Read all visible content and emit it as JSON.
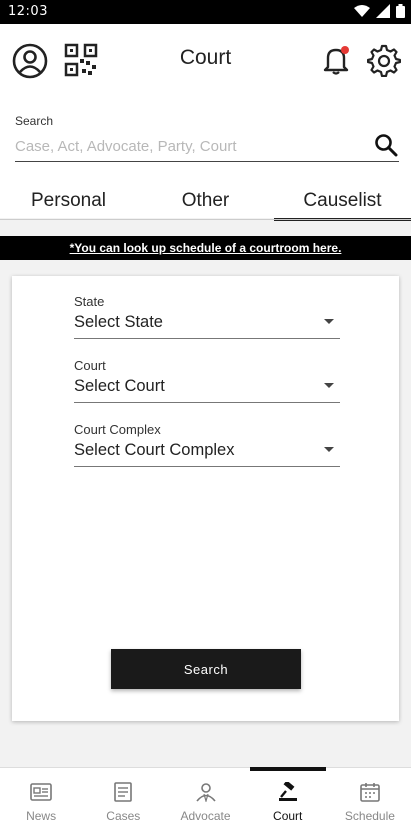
{
  "status_bar": {
    "time": "12:03"
  },
  "header": {
    "title": "Court"
  },
  "search": {
    "label": "Search",
    "placeholder": "Case, Act, Advocate, Party, Court",
    "value": ""
  },
  "tabs": [
    {
      "label": "Personal",
      "active": false
    },
    {
      "label": "Other",
      "active": false
    },
    {
      "label": "Causelist",
      "active": true
    }
  ],
  "notice": {
    "text": "*You can look up schedule of a courtroom here."
  },
  "form": {
    "state": {
      "label": "State",
      "value": "Select State"
    },
    "court": {
      "label": "Court",
      "value": "Select Court"
    },
    "court_complex": {
      "label": "Court Complex",
      "value": "Select Court Complex"
    },
    "submit_label": "Search"
  },
  "bottom_nav": [
    {
      "label": "News",
      "icon": "news-icon",
      "active": false
    },
    {
      "label": "Cases",
      "icon": "cases-icon",
      "active": false
    },
    {
      "label": "Advocate",
      "icon": "advocate-icon",
      "active": false
    },
    {
      "label": "Court",
      "icon": "gavel-icon",
      "active": true
    },
    {
      "label": "Schedule",
      "icon": "calendar-icon",
      "active": false
    }
  ],
  "colors": {
    "accent": "#1a1a1a",
    "notification_dot": "#e53935",
    "background": "#f2f2f2"
  }
}
